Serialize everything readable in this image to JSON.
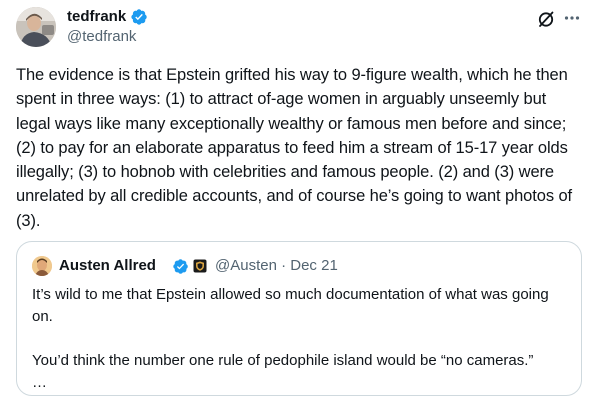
{
  "author": {
    "display_name": "tedfrank",
    "handle": "@tedfrank",
    "verified": true,
    "avatar_icon": "profile-photo"
  },
  "actions": {
    "grok_icon": "slashed-circle-icon",
    "more_icon": "ellipsis-icon"
  },
  "tweet": {
    "text": "The evidence is that Epstein grifted his way to 9-figure wealth, which he then spent in three ways: (1) to attract of-age women in arguably unseemly but legal ways like many exceptionally wealthy or famous men before and since; (2) to pay for an elaborate apparatus to feed him a stream of 15-17 year olds illegally; (3) to hobnob with celebrities and famous people. (2) and (3) were unrelated by all credible accounts, and of course he’s going to want photos of (3)."
  },
  "quoted": {
    "display_name": "Austen Allred",
    "handle_date": "@Austen · Dec 21",
    "verified": true,
    "affiliation_icon": "shield-badge-icon",
    "text": "It’s wild to me that Epstein allowed so much documentation of what was going on.\n\nYou’d think the number one rule of pedophile island would be “no cameras.”\n…"
  },
  "colors": {
    "text_primary": "#0f1419",
    "text_secondary": "#536471",
    "verified_blue": "#1d9bf0",
    "border": "#cfd9de"
  }
}
